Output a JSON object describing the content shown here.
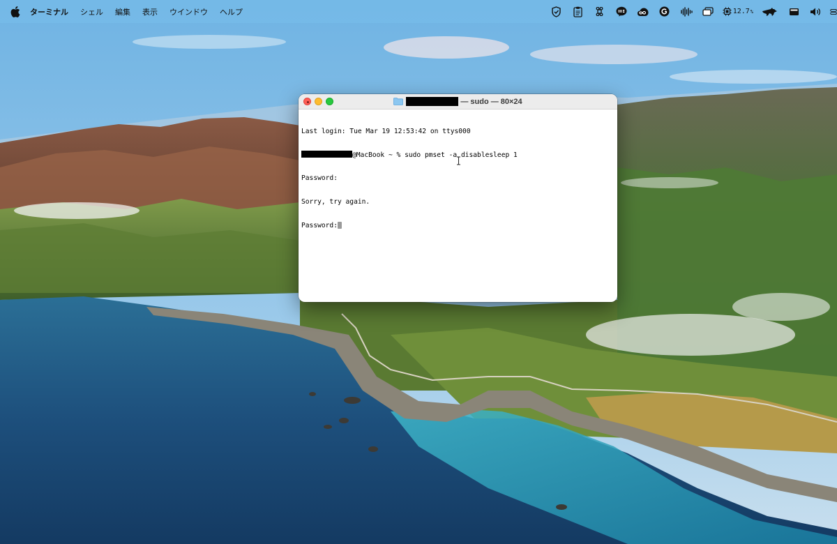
{
  "menubar": {
    "app_name": "ターミナル",
    "items": [
      "シェル",
      "編集",
      "表示",
      "ウインドウ",
      "ヘルプ"
    ],
    "cpu_value": "12.7",
    "cpu_unit": "%",
    "status_icons": [
      "shield-icon",
      "clipboard-icon",
      "command-key-icon",
      "line-app-icon",
      "creative-cloud-icon",
      "grammarly-icon",
      "audio-waveform-icon",
      "window-switcher-icon",
      "cpu-icon",
      "runcat-icon",
      "display-icon",
      "volume-icon"
    ]
  },
  "window": {
    "title_suffix": "— sudo — 80×24",
    "lines": {
      "last_login": "Last login: Tue Mar 19 12:53:42 on ttys000",
      "prompt_suffix": "@MacBook ~ % sudo pmset -a disablesleep 1",
      "password_1": "Password:",
      "sorry": "Sorry, try again.",
      "password_2": "Password:"
    }
  },
  "colors": {
    "close": "#ff5f57",
    "minimize": "#febc2e",
    "zoom": "#28c840",
    "titlebar": "#ececec"
  }
}
